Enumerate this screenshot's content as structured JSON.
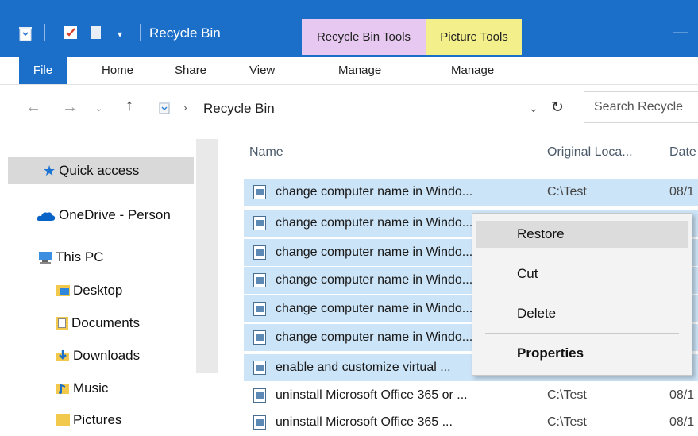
{
  "window": {
    "title": "Recycle Bin",
    "context_tabs": [
      {
        "label": "Recycle Bin Tools",
        "color": "#e6c8f0"
      },
      {
        "label": "Picture Tools",
        "color": "#f3f08c"
      }
    ],
    "minimize_glyph": "—"
  },
  "ribbon": {
    "file": "File",
    "tabs": [
      "Home",
      "Share",
      "View",
      "Manage",
      "Manage"
    ]
  },
  "address": {
    "path": "Recycle Bin",
    "search_placeholder": "Search Recycle"
  },
  "nav": {
    "items": [
      {
        "label": "Quick access",
        "icon": "star-icon"
      },
      {
        "label": "OneDrive - Person",
        "icon": "cloud-icon"
      },
      {
        "label": "This PC",
        "icon": "computer-icon"
      },
      {
        "label": "Desktop",
        "icon": "desktop-folder-icon"
      },
      {
        "label": "Documents",
        "icon": "documents-folder-icon"
      },
      {
        "label": "Downloads",
        "icon": "downloads-folder-icon"
      },
      {
        "label": "Music",
        "icon": "music-folder-icon"
      },
      {
        "label": "Pictures",
        "icon": "pictures-folder-icon"
      }
    ]
  },
  "columns": {
    "name": "Name",
    "location": "Original Loca...",
    "date": "Date"
  },
  "files": [
    {
      "name": "change computer name in Windo...",
      "location": "C:\\Test",
      "date": "08/1",
      "selected": true
    },
    {
      "name": "change computer name in Windo...",
      "location": "",
      "date": "",
      "selected": true
    },
    {
      "name": "change computer name in Windo...",
      "location": "",
      "date": "",
      "selected": true
    },
    {
      "name": "change computer name in Windo...",
      "location": "",
      "date": "",
      "selected": true
    },
    {
      "name": "change computer name in Windo...",
      "location": "",
      "date": "",
      "selected": true
    },
    {
      "name": "change computer name in Windo...",
      "location": "",
      "date": "",
      "selected": true
    },
    {
      "name": "enable and customize virtual ...",
      "location": "",
      "date": "",
      "selected": true
    },
    {
      "name": "uninstall Microsoft Office 365 or ...",
      "location": "C:\\Test",
      "date": "08/1",
      "selected": false
    },
    {
      "name": "uninstall Microsoft Office 365 ...",
      "location": "C:\\Test",
      "date": "08/1",
      "selected": false
    }
  ],
  "context_menu": {
    "restore": "Restore",
    "cut": "Cut",
    "delete": "Delete",
    "properties": "Properties"
  },
  "colors": {
    "accent": "#1c6fc9",
    "selection": "#cce4f7"
  }
}
